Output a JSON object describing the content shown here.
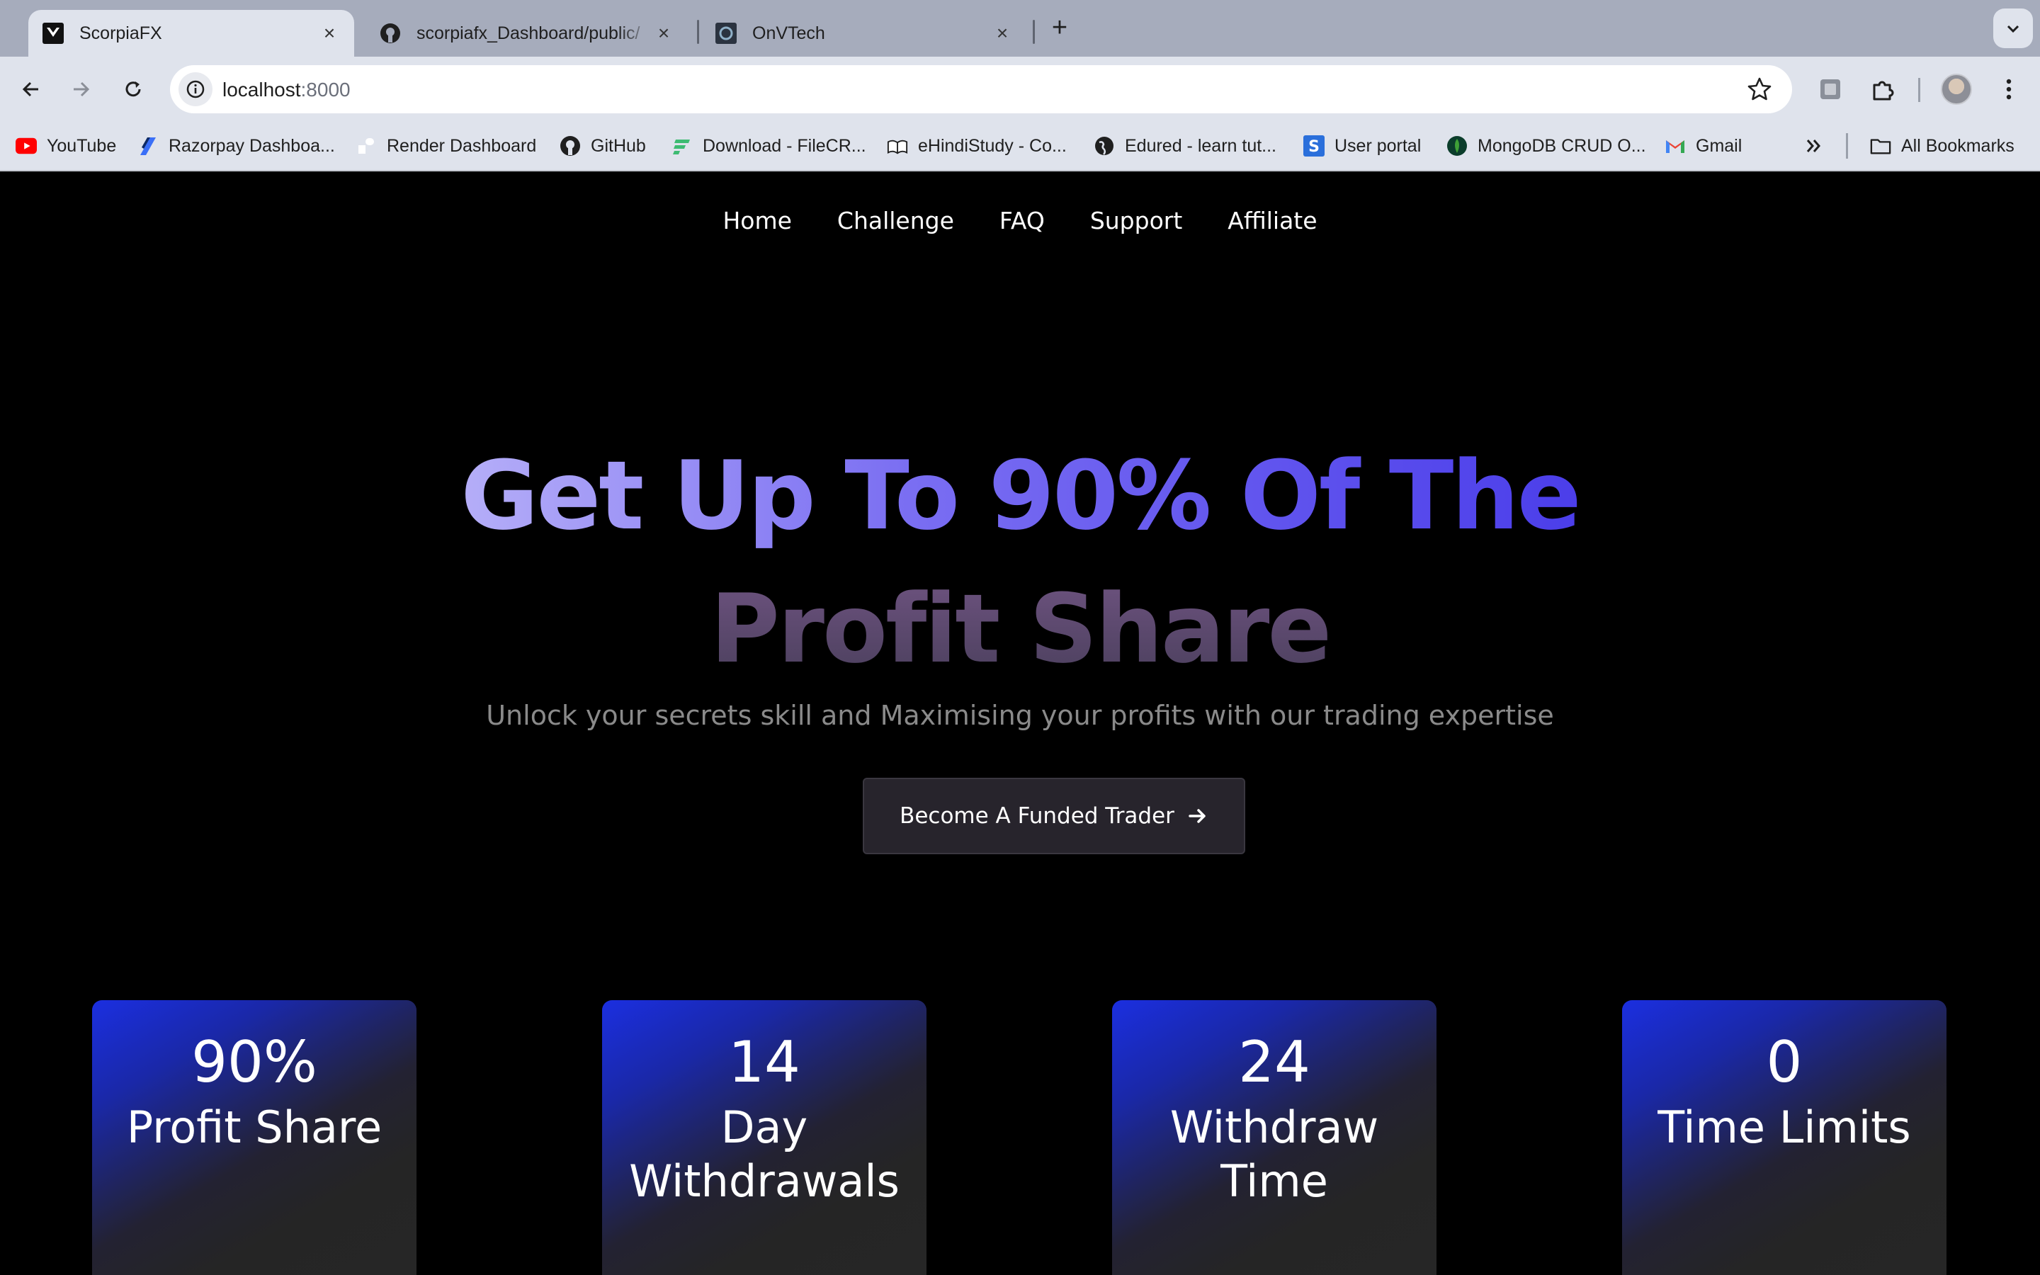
{
  "browser": {
    "tabs": [
      {
        "title": "ScorpiaFX",
        "active": true
      },
      {
        "title": "scorpiafx_Dashboard/public/",
        "active": false
      },
      {
        "title": "OnVTech",
        "active": false
      }
    ],
    "url_host": "localhost",
    "url_port": ":8000",
    "bookmarks": [
      "YouTube",
      "Razorpay Dashboa...",
      "Render Dashboard",
      "GitHub",
      "Download - FileCR...",
      "eHindiStudy - Co...",
      "Edured - learn tut...",
      "User portal",
      "MongoDB CRUD O...",
      "Gmail"
    ],
    "all_bookmarks": "All Bookmarks"
  },
  "site": {
    "nav": [
      "Home",
      "Challenge",
      "FAQ",
      "Support",
      "Affiliate"
    ],
    "hero": {
      "line1": "Get Up To 90% Of The",
      "line2": "Profit Share",
      "subtitle": "Unlock your secrets skill and Maximising your profits with our trading expertise",
      "cta": "Become A Funded Trader"
    },
    "stats": [
      {
        "value": "90%",
        "label": "Profit Share"
      },
      {
        "value": "14",
        "label": "Day Withdrawals"
      },
      {
        "value": "24",
        "label": "Withdraw Time"
      },
      {
        "value": "0",
        "label": "Time Limits"
      }
    ]
  },
  "colors": {
    "page_bg": "#000000",
    "accent_blue": "#1b2fe0",
    "title_gradient_start": "#b5aef8",
    "title_gradient_end": "#4b3eea",
    "cta_bg": "#27242c"
  }
}
